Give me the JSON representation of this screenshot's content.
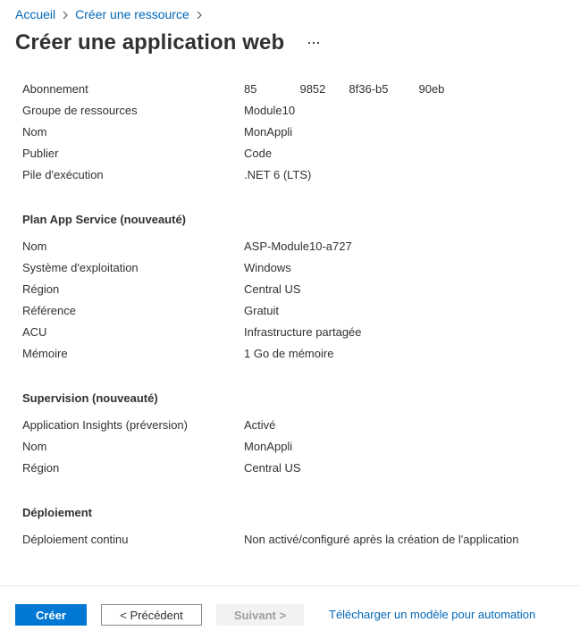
{
  "breadcrumb": {
    "items": [
      "Accueil",
      "Créer une ressource"
    ]
  },
  "page": {
    "title": "Créer une application web",
    "more_label": "..."
  },
  "basics": {
    "rows": [
      {
        "label": "Abonnement",
        "value_parts": [
          "85",
          "9852",
          "8f36-b5",
          "90eb"
        ]
      },
      {
        "label": "Groupe de ressources",
        "value": "Module10"
      },
      {
        "label": "Nom",
        "value": "MonAppli"
      },
      {
        "label": "Publier",
        "value": "Code"
      },
      {
        "label": "Pile d'exécution",
        "value": ".NET 6 (LTS)"
      }
    ]
  },
  "app_service_plan": {
    "heading": "Plan App Service (nouveauté)",
    "rows": [
      {
        "label": "Nom",
        "value": "ASP-Module10-a727"
      },
      {
        "label": "Système d'exploitation",
        "value": "Windows"
      },
      {
        "label": "Région",
        "value": "Central US"
      },
      {
        "label": "Référence",
        "value": "Gratuit"
      },
      {
        "label": "ACU",
        "value": "Infrastructure partagée"
      },
      {
        "label": "Mémoire",
        "value": "1 Go de mémoire"
      }
    ]
  },
  "monitoring": {
    "heading": "Supervision (nouveauté)",
    "rows": [
      {
        "label": "Application Insights (préversion)",
        "value": "Activé"
      },
      {
        "label": "Nom",
        "value": "MonAppli"
      },
      {
        "label": "Région",
        "value": "Central US"
      }
    ]
  },
  "deployment": {
    "heading": "Déploiement",
    "rows": [
      {
        "label": "Déploiement continu",
        "value": "Non activé/configuré après la création de l'application"
      }
    ]
  },
  "footer": {
    "create_label": "Créer",
    "previous_label": "< Précédent",
    "next_label": "Suivant >",
    "template_link": "Télécharger un modèle pour automation"
  },
  "colors": {
    "accent": "#0078d4",
    "link": "#0067b8",
    "text": "#323130",
    "disabled_bg": "#f3f2f1",
    "disabled_text": "#a19f9d"
  }
}
